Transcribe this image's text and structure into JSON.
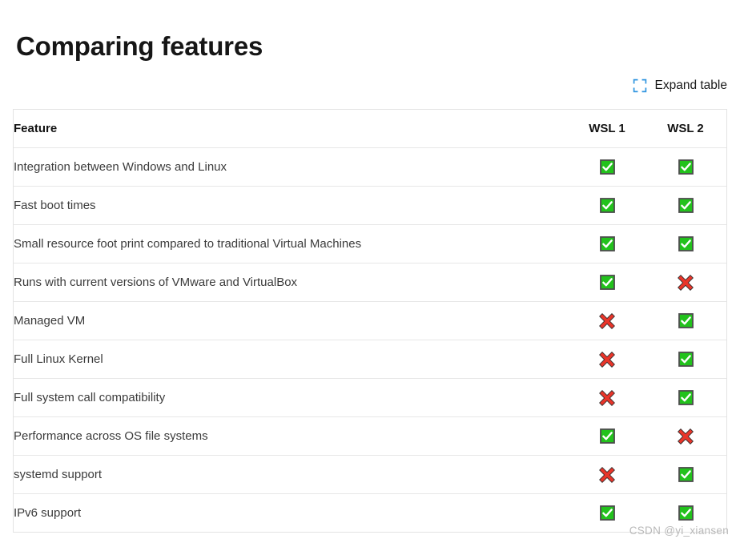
{
  "page": {
    "title": "Comparing features",
    "watermark": "CSDN @yi_xiansen"
  },
  "toolbar": {
    "expand_label": "Expand table",
    "expand_icon": "expand-corners-icon",
    "expand_icon_color": "#3196e0"
  },
  "colors": {
    "check_fill": "#22c21c",
    "check_border": "#4d4d4d",
    "check_glyph": "#ffffff",
    "cross_fill": "#e8352a",
    "cross_border": "#2f2f2f",
    "table_border": "#e3e3e3",
    "row_border": "#e7e7e7",
    "text": "#3b3b3b",
    "heading": "#131313"
  },
  "table": {
    "columns": [
      "Feature",
      "WSL 1",
      "WSL 2"
    ],
    "rows": [
      {
        "feature": "Integration between Windows and Linux",
        "wsl1": "check",
        "wsl2": "check"
      },
      {
        "feature": "Fast boot times",
        "wsl1": "check",
        "wsl2": "check"
      },
      {
        "feature": "Small resource foot print compared to traditional Virtual Machines",
        "wsl1": "check",
        "wsl2": "check"
      },
      {
        "feature": "Runs with current versions of VMware and VirtualBox",
        "wsl1": "check",
        "wsl2": "cross"
      },
      {
        "feature": "Managed VM",
        "wsl1": "cross",
        "wsl2": "check"
      },
      {
        "feature": "Full Linux Kernel",
        "wsl1": "cross",
        "wsl2": "check"
      },
      {
        "feature": "Full system call compatibility",
        "wsl1": "cross",
        "wsl2": "check"
      },
      {
        "feature": "Performance across OS file systems",
        "wsl1": "check",
        "wsl2": "cross"
      },
      {
        "feature": "systemd support",
        "wsl1": "cross",
        "wsl2": "check"
      },
      {
        "feature": "IPv6 support",
        "wsl1": "check",
        "wsl2": "check"
      }
    ]
  }
}
